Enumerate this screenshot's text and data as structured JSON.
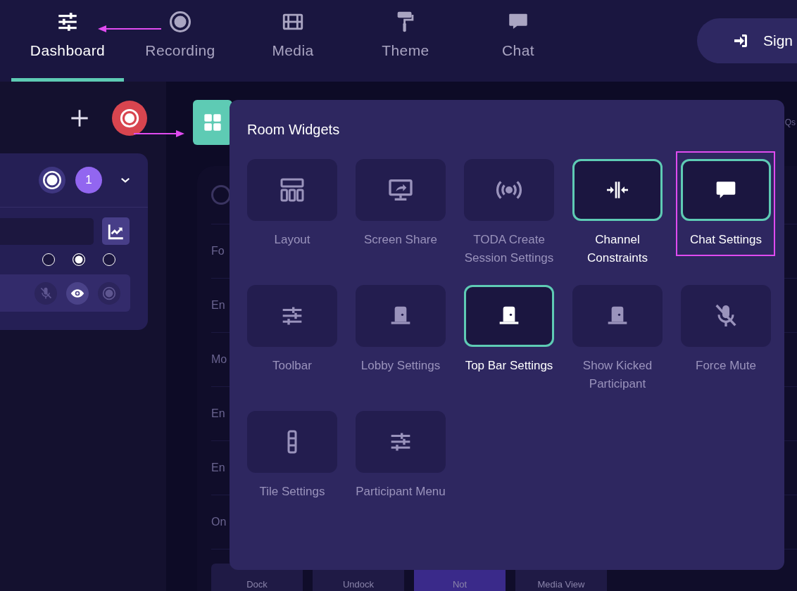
{
  "nav": {
    "tabs": [
      {
        "label": "Dashboard",
        "selected": true
      },
      {
        "label": "Recording",
        "selected": false
      },
      {
        "label": "Media",
        "selected": false
      },
      {
        "label": "Theme",
        "selected": false
      },
      {
        "label": "Chat",
        "selected": false
      }
    ],
    "sign_button": {
      "label": "Sign"
    }
  },
  "sidebar": {
    "card": {
      "badge": "1",
      "radios": [
        {
          "selected": false
        },
        {
          "selected": true
        },
        {
          "selected": false
        }
      ],
      "row_buttons": [
        {
          "on": false
        },
        {
          "on": true
        },
        {
          "on": false
        }
      ]
    }
  },
  "settings_panel": {
    "header_fragment": "Qs",
    "radio": {
      "selected": false
    },
    "rows": [
      "Fo",
      "En",
      "Mo",
      "En",
      "En",
      "On"
    ],
    "view_buttons": [
      {
        "label": "Dock",
        "selected": false
      },
      {
        "label": "Undock",
        "selected": false
      },
      {
        "label": "Not",
        "selected": true
      },
      {
        "label": "Media View",
        "selected": false
      }
    ]
  },
  "room_widgets": {
    "title": "Room Widgets",
    "items": [
      {
        "label": "Layout",
        "selected": false,
        "highlighted": false
      },
      {
        "label": "Screen Share",
        "selected": false,
        "highlighted": false
      },
      {
        "label": "TODA Create Session Settings",
        "selected": false,
        "highlighted": false
      },
      {
        "label": "Channel Constraints",
        "selected": true,
        "highlighted": false
      },
      {
        "label": "Chat Settings",
        "selected": true,
        "highlighted": true
      },
      {
        "label": "Toolbar",
        "selected": false,
        "highlighted": false
      },
      {
        "label": "Lobby Settings",
        "selected": false,
        "highlighted": false
      },
      {
        "label": "Top Bar Settings",
        "selected": true,
        "highlighted": false
      },
      {
        "label": "Show Kicked Participant",
        "selected": false,
        "highlighted": false
      },
      {
        "label": "Force Mute",
        "selected": false,
        "highlighted": false
      },
      {
        "label": "Tile Settings",
        "selected": false,
        "highlighted": false
      },
      {
        "label": "Participant Menu",
        "selected": false,
        "highlighted": false
      }
    ]
  }
}
